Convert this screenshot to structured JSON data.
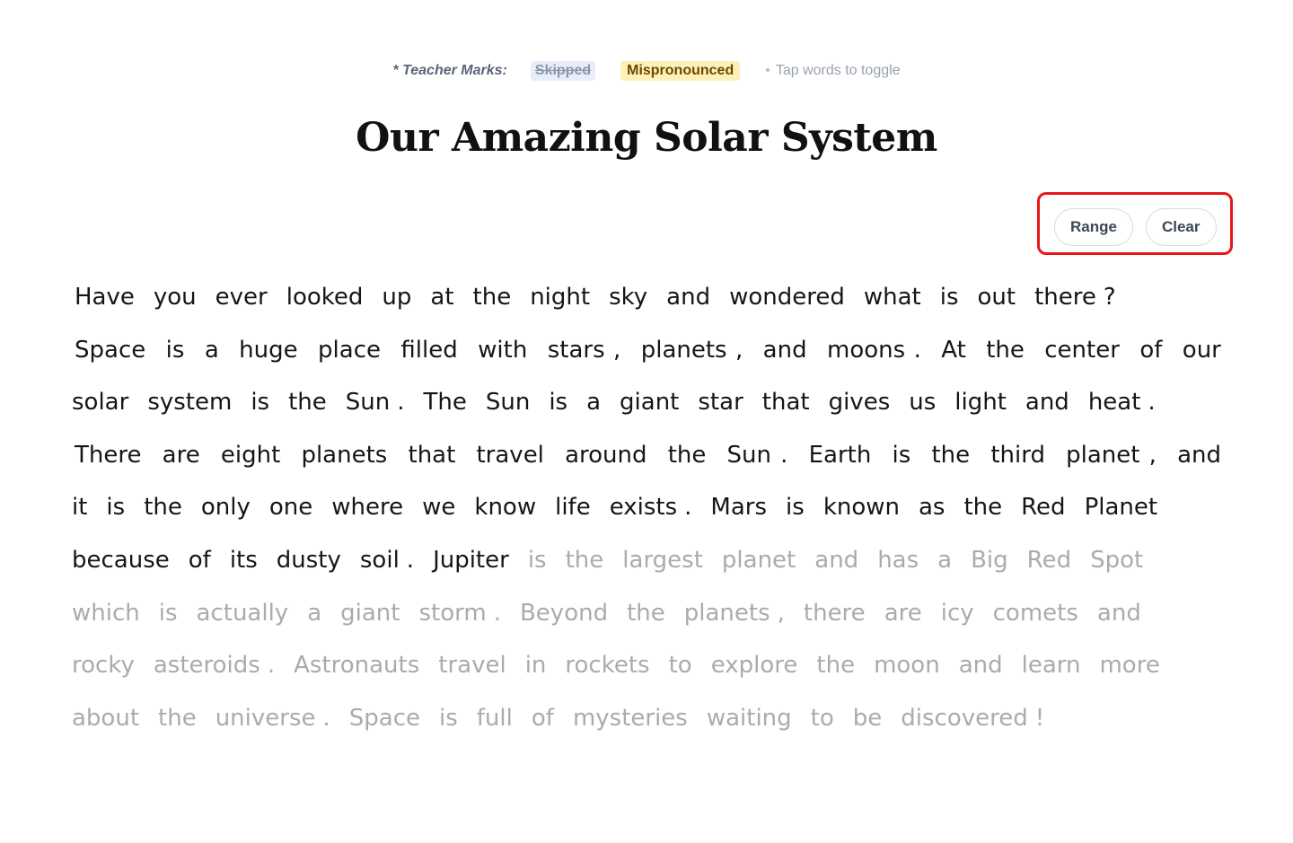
{
  "legend": {
    "label": "* Teacher Marks:",
    "skipped": "Skipped",
    "mispronounced": "Mispronounced",
    "dot": "•",
    "hint": "Tap words to toggle"
  },
  "title": "Our Amazing Solar System",
  "controls": {
    "range": "Range",
    "clear": "Clear"
  },
  "passage": {
    "lines": [
      {
        "ragged": true,
        "indent": true,
        "tokens": [
          {
            "t": "Have",
            "r": 1
          },
          {
            "t": "you",
            "r": 1
          },
          {
            "t": "ever",
            "r": 1
          },
          {
            "t": "looked",
            "r": 1
          },
          {
            "t": "up",
            "r": 1
          },
          {
            "t": "at",
            "r": 1
          },
          {
            "t": "the",
            "r": 1
          },
          {
            "t": "night",
            "r": 1
          },
          {
            "t": "sky",
            "r": 1
          },
          {
            "t": "and",
            "r": 1
          },
          {
            "t": "wondered",
            "r": 1
          },
          {
            "t": "what",
            "r": 1
          },
          {
            "t": "is",
            "r": 1
          },
          {
            "t": "out",
            "r": 1
          },
          {
            "t": "there",
            "r": 1
          },
          {
            "t": "?",
            "r": 1,
            "p": 1
          }
        ]
      },
      {
        "ragged": false,
        "indent": true,
        "tokens": [
          {
            "t": "Space",
            "r": 1
          },
          {
            "t": "is",
            "r": 1
          },
          {
            "t": "a",
            "r": 1
          },
          {
            "t": "huge",
            "r": 1
          },
          {
            "t": "place",
            "r": 1
          },
          {
            "t": "filled",
            "r": 1
          },
          {
            "t": "with",
            "r": 1
          },
          {
            "t": "stars",
            "r": 1
          },
          {
            "t": ",",
            "r": 1,
            "p": 1
          },
          {
            "t": "planets",
            "r": 1
          },
          {
            "t": ",",
            "r": 1,
            "p": 1
          },
          {
            "t": "and",
            "r": 1
          },
          {
            "t": "moons",
            "r": 1
          },
          {
            "t": ".",
            "r": 1,
            "p": 1
          },
          {
            "t": "At",
            "r": 1
          },
          {
            "t": "the",
            "r": 1
          },
          {
            "t": "center",
            "r": 1
          },
          {
            "t": "of",
            "r": 1
          },
          {
            "t": "our",
            "r": 1
          }
        ]
      },
      {
        "ragged": true,
        "indent": false,
        "tokens": [
          {
            "t": "solar",
            "r": 1
          },
          {
            "t": "system",
            "r": 1
          },
          {
            "t": "is",
            "r": 1
          },
          {
            "t": "the",
            "r": 1
          },
          {
            "t": "Sun",
            "r": 1
          },
          {
            "t": ".",
            "r": 1,
            "p": 1
          },
          {
            "t": "The",
            "r": 1
          },
          {
            "t": "Sun",
            "r": 1
          },
          {
            "t": "is",
            "r": 1
          },
          {
            "t": "a",
            "r": 1
          },
          {
            "t": "giant",
            "r": 1
          },
          {
            "t": "star",
            "r": 1
          },
          {
            "t": "that",
            "r": 1
          },
          {
            "t": "gives",
            "r": 1
          },
          {
            "t": "us",
            "r": 1
          },
          {
            "t": "light",
            "r": 1
          },
          {
            "t": "and",
            "r": 1
          },
          {
            "t": "heat",
            "r": 1
          },
          {
            "t": ".",
            "r": 1,
            "p": 1
          }
        ]
      },
      {
        "ragged": false,
        "indent": true,
        "tokens": [
          {
            "t": "There",
            "r": 1
          },
          {
            "t": "are",
            "r": 1
          },
          {
            "t": "eight",
            "r": 1
          },
          {
            "t": "planets",
            "r": 1
          },
          {
            "t": "that",
            "r": 1
          },
          {
            "t": "travel",
            "r": 1
          },
          {
            "t": "around",
            "r": 1
          },
          {
            "t": "the",
            "r": 1
          },
          {
            "t": "Sun",
            "r": 1
          },
          {
            "t": ".",
            "r": 1,
            "p": 1
          },
          {
            "t": "Earth",
            "r": 1
          },
          {
            "t": "is",
            "r": 1
          },
          {
            "t": "the",
            "r": 1
          },
          {
            "t": "third",
            "r": 1
          },
          {
            "t": "planet",
            "r": 1
          },
          {
            "t": ",",
            "r": 1,
            "p": 1
          },
          {
            "t": "and",
            "r": 1
          }
        ]
      },
      {
        "ragged": true,
        "indent": false,
        "tokens": [
          {
            "t": "it",
            "r": 1
          },
          {
            "t": "is",
            "r": 1
          },
          {
            "t": "the",
            "r": 1
          },
          {
            "t": "only",
            "r": 1
          },
          {
            "t": "one",
            "r": 1
          },
          {
            "t": "where",
            "r": 1
          },
          {
            "t": "we",
            "r": 1
          },
          {
            "t": "know",
            "r": 1
          },
          {
            "t": "life",
            "r": 1
          },
          {
            "t": "exists",
            "r": 1
          },
          {
            "t": ".",
            "r": 1,
            "p": 1
          },
          {
            "t": "Mars",
            "r": 1
          },
          {
            "t": "is",
            "r": 1
          },
          {
            "t": "known",
            "r": 1
          },
          {
            "t": "as",
            "r": 1
          },
          {
            "t": "the",
            "r": 1
          },
          {
            "t": "Red",
            "r": 1
          },
          {
            "t": "Planet",
            "r": 1
          }
        ]
      },
      {
        "ragged": true,
        "indent": false,
        "tokens": [
          {
            "t": "because",
            "r": 1
          },
          {
            "t": "of",
            "r": 1
          },
          {
            "t": "its",
            "r": 1
          },
          {
            "t": "dusty",
            "r": 1
          },
          {
            "t": "soil",
            "r": 1
          },
          {
            "t": ".",
            "r": 1,
            "p": 1
          },
          {
            "t": "Jupiter",
            "r": 1
          },
          {
            "t": "is",
            "r": 0
          },
          {
            "t": "the",
            "r": 0
          },
          {
            "t": "largest",
            "r": 0
          },
          {
            "t": "planet",
            "r": 0
          },
          {
            "t": "and",
            "r": 0
          },
          {
            "t": "has",
            "r": 0
          },
          {
            "t": "a",
            "r": 0
          },
          {
            "t": "Big",
            "r": 0
          },
          {
            "t": "Red",
            "r": 0
          },
          {
            "t": "Spot",
            "r": 0
          }
        ]
      },
      {
        "ragged": true,
        "indent": false,
        "tokens": [
          {
            "t": "which",
            "r": 0
          },
          {
            "t": "is",
            "r": 0
          },
          {
            "t": "actually",
            "r": 0
          },
          {
            "t": "a",
            "r": 0
          },
          {
            "t": "giant",
            "r": 0
          },
          {
            "t": "storm",
            "r": 0
          },
          {
            "t": ".",
            "r": 0,
            "p": 1
          },
          {
            "t": "Beyond",
            "r": 0
          },
          {
            "t": "the",
            "r": 0
          },
          {
            "t": "planets",
            "r": 0
          },
          {
            "t": ",",
            "r": 0,
            "p": 1
          },
          {
            "t": "there",
            "r": 0
          },
          {
            "t": "are",
            "r": 0
          },
          {
            "t": "icy",
            "r": 0
          },
          {
            "t": "comets",
            "r": 0
          },
          {
            "t": "and",
            "r": 0
          }
        ]
      },
      {
        "ragged": true,
        "indent": false,
        "tokens": [
          {
            "t": "rocky",
            "r": 0
          },
          {
            "t": "asteroids",
            "r": 0
          },
          {
            "t": ".",
            "r": 0,
            "p": 1
          },
          {
            "t": "Astronauts",
            "r": 0
          },
          {
            "t": "travel",
            "r": 0
          },
          {
            "t": "in",
            "r": 0
          },
          {
            "t": "rockets",
            "r": 0
          },
          {
            "t": "to",
            "r": 0
          },
          {
            "t": "explore",
            "r": 0
          },
          {
            "t": "the",
            "r": 0
          },
          {
            "t": "moon",
            "r": 0
          },
          {
            "t": "and",
            "r": 0
          },
          {
            "t": "learn",
            "r": 0
          },
          {
            "t": "more",
            "r": 0
          }
        ]
      },
      {
        "ragged": true,
        "indent": false,
        "tokens": [
          {
            "t": "about",
            "r": 0
          },
          {
            "t": "the",
            "r": 0
          },
          {
            "t": "universe",
            "r": 0
          },
          {
            "t": ".",
            "r": 0,
            "p": 1
          },
          {
            "t": "Space",
            "r": 0
          },
          {
            "t": "is",
            "r": 0
          },
          {
            "t": "full",
            "r": 0
          },
          {
            "t": "of",
            "r": 0
          },
          {
            "t": "mysteries",
            "r": 0
          },
          {
            "t": "waiting",
            "r": 0
          },
          {
            "t": "to",
            "r": 0
          },
          {
            "t": "be",
            "r": 0
          },
          {
            "t": "discovered",
            "r": 0
          },
          {
            "t": "!",
            "r": 0,
            "p": 1
          }
        ]
      }
    ]
  }
}
